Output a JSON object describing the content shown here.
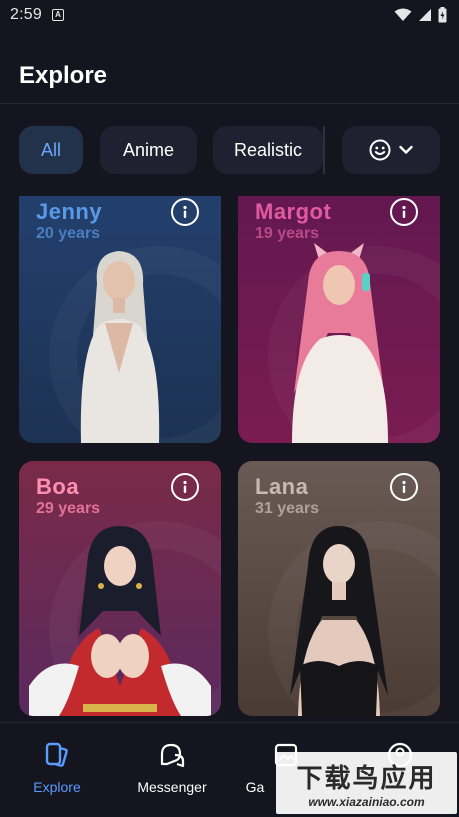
{
  "status_bar": {
    "time": "2:59",
    "notification_glyph": "A"
  },
  "header": {
    "title": "Explore"
  },
  "filters": {
    "chips": [
      "All",
      "Anime",
      "Realistic"
    ],
    "active": "All",
    "emoji_filter_icon": "smiley-icon"
  },
  "cards": [
    {
      "name": "Jenny",
      "age": "20 years",
      "name_color": "#5b9ae6",
      "age_color": "#4f86c9"
    },
    {
      "name": "Margot",
      "age": "19 years",
      "name_color": "#e05aa0",
      "age_color": "#c24f8c"
    },
    {
      "name": "Boa",
      "age": "29 years",
      "name_color": "#ff8fb1",
      "age_color": "#f07ba0"
    },
    {
      "name": "Lana",
      "age": "31 years",
      "name_color": "#c8b9b2",
      "age_color": "#b9aaa3"
    }
  ],
  "bottom_nav": {
    "items": [
      {
        "label": "Explore",
        "icon": "explore-cards-icon",
        "active": true
      },
      {
        "label": "Messenger",
        "icon": "messenger-icon",
        "active": false
      },
      {
        "label": "Ga",
        "icon": "gallery-icon",
        "active": false
      },
      {
        "label": "",
        "icon": "profile-icon",
        "active": false
      }
    ]
  },
  "watermark": {
    "main": "下载鸟应用",
    "sub": "www.xiazainiao.com"
  },
  "colors": {
    "background": "#14151f",
    "accent": "#5a9bff",
    "chip_bg": "#1f2130"
  }
}
